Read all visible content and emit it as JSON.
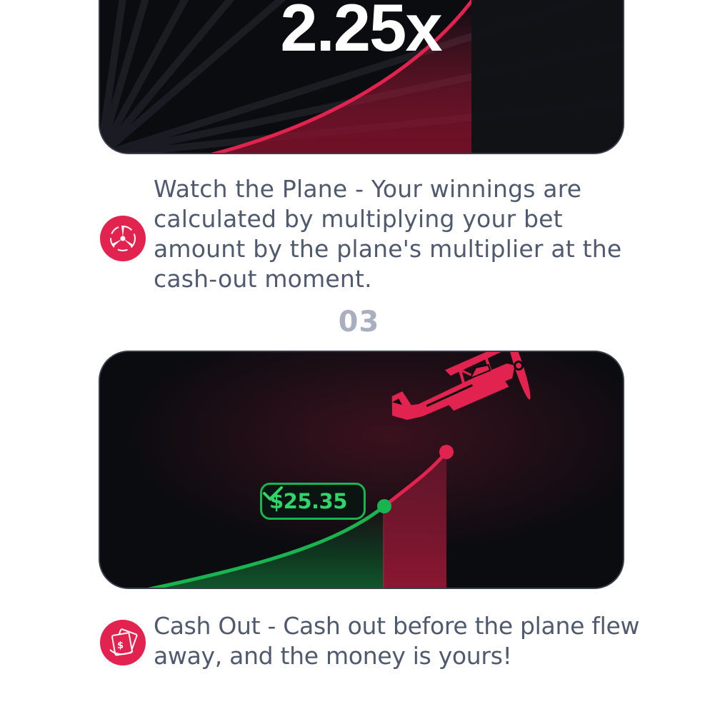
{
  "step2": {
    "multiplier_display": "2.25x",
    "description": "Watch the Plane - Your winnings are calculated by multiplying your bet amount by the plane's multiplier at the cash-out moment.",
    "icon": "propeller-icon"
  },
  "step3": {
    "number": "03",
    "cashout_amount": "$25.35",
    "description": "Cash Out - Cash out before the plane flew away, and the money is yours!",
    "icon": "cash-icon"
  },
  "colors": {
    "accent_red": "#e3234f",
    "success_green": "#19b34f",
    "card_background": "#0b0c10",
    "text_gray": "#4f5a6e",
    "number_gray": "#a9afbf"
  }
}
